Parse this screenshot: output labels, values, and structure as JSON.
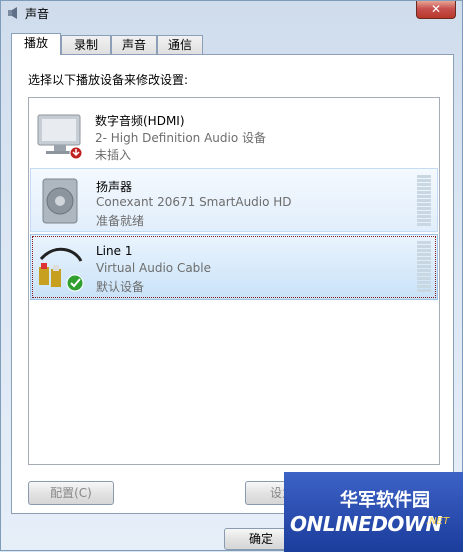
{
  "window": {
    "title": "声音",
    "close_label": "✕"
  },
  "tabs": [
    {
      "label": "播放",
      "active": true
    },
    {
      "label": "录制",
      "active": false
    },
    {
      "label": "声音",
      "active": false
    },
    {
      "label": "通信",
      "active": false
    }
  ],
  "instruction": "选择以下播放设备来修改设置:",
  "devices": [
    {
      "name": "数字音频(HDMI)",
      "description": "2- High Definition Audio 设备",
      "status": "未插入"
    },
    {
      "name": "扬声器",
      "description": "Conexant 20671 SmartAudio HD",
      "status": "准备就绪"
    },
    {
      "name": "Line 1",
      "description": "Virtual Audio Cable",
      "status": "默认设备"
    }
  ],
  "buttons": {
    "configure": "配置(C)",
    "set_default": "设为默",
    "ok": "确定"
  },
  "watermark": {
    "cn": "华军软件园",
    "en": "ONLINEDOWN",
    "suffix": ".NET"
  },
  "colors": {
    "selection": "#c9e2f8",
    "focus_border": "#8b1a1a"
  }
}
